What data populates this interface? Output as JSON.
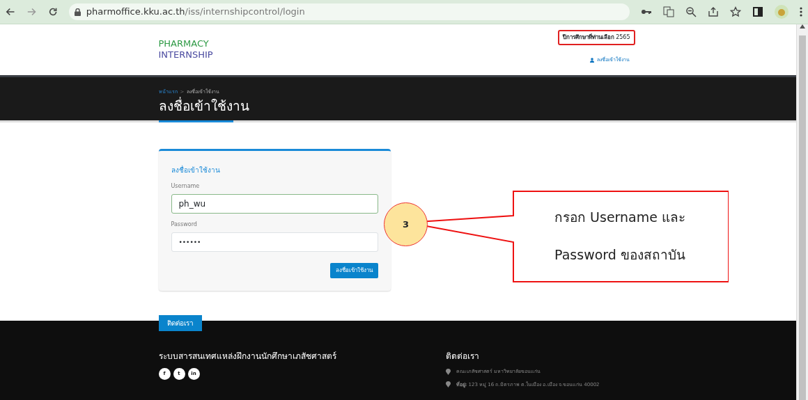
{
  "browser": {
    "url_host": "pharmoffice.kku.ac.th",
    "url_path": "/iss/internshipcontrol/login"
  },
  "header": {
    "logo_line1": "PHARMACY",
    "logo_line2": "INTERNSHIP",
    "year_label": "ปีการศึกษาที่ท่านเลือก",
    "year": "2565",
    "login_link": "ลงชื่อเข้าใช้งาน"
  },
  "banner": {
    "breadcrumb": [
      {
        "label": "หน้าแรก",
        "selected": false
      },
      {
        "label": "ลงชื่อเข้าใช้งาน",
        "selected": true
      }
    ],
    "separator": ">",
    "title": "ลงชื่อเข้าใช้งาน"
  },
  "login_form": {
    "title": "ลงชื่อเข้าใช้งาน",
    "fields": [
      {
        "label": "Username",
        "value": "ph_wu",
        "kind": "text",
        "focused": true
      },
      {
        "label": "Password",
        "value": "••••••",
        "kind": "password",
        "focused": false
      }
    ],
    "submit": "ลงชื่อเข้าใช้งาน"
  },
  "annotation": {
    "step": "3",
    "lines": [
      "กรอก Username และ",
      "Password ของสถาบัน"
    ]
  },
  "footer": {
    "tab": "ติดต่อเรา",
    "left_title": "ระบบสารสนเทศแหล่งฝึกงานนักศึกษาเภสัชศาสตร์",
    "social": [
      "f",
      "t",
      "in"
    ],
    "right_title": "ติดต่อเรา",
    "contacts": [
      "คณะเภสัชศาสตร์ มหาวิทยาลัยขอนแก่น",
      "**ที่อยู่:** 123 หมู่ 16 ถ.มิตรภาพ ต.ในเมือง อ.เมือง จ.ขอนแก่น 40002"
    ]
  }
}
